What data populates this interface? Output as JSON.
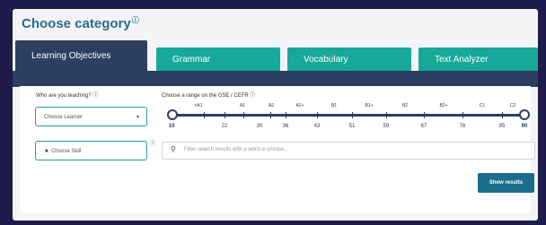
{
  "header": {
    "title": "Choose category",
    "info_icon": "info-circle-icon"
  },
  "tabs": [
    {
      "label": "Learning Objectives",
      "active": true
    },
    {
      "label": "Grammar",
      "active": false
    },
    {
      "label": "Vocabulary",
      "active": false
    },
    {
      "label": "Text Analyzer",
      "active": false
    }
  ],
  "learner": {
    "label": "Who are you teaching?",
    "select_value": "Choose Learner"
  },
  "skill": {
    "select_value": "Choose Skill",
    "icon": "skill-icon"
  },
  "range": {
    "label": "Choose a range on the GSE / CEFR",
    "cefr_labels": [
      "<A1",
      "A1",
      "A2",
      "A2+",
      "B1",
      "B1+",
      "B2",
      "B2+",
      "C1",
      "C2"
    ],
    "gse_min": "10",
    "gse_max": "90",
    "gse_ticks": [
      "22",
      "30",
      "36",
      "43",
      "51",
      "59",
      "67",
      "76",
      "85"
    ]
  },
  "search": {
    "placeholder": "Filter search results with a word or phrase..."
  },
  "actions": {
    "show_results": "Show results"
  },
  "colors": {
    "accent": "#2a6e8c",
    "tab_active": "#2c3f60",
    "tab_inactive": "#17a89a",
    "button": "#1b6e8a",
    "background": "#1f1b4a"
  }
}
